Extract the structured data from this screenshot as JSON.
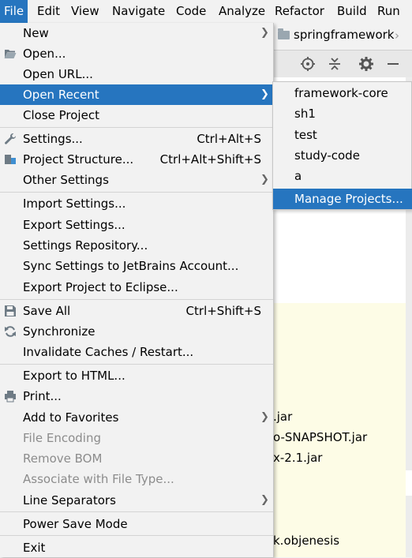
{
  "menubar": {
    "items": [
      "File",
      "Edit",
      "View",
      "Navigate",
      "Code",
      "Analyze",
      "Refactor",
      "Build",
      "Run"
    ],
    "active_item": "File"
  },
  "breadcrumb": {
    "project": "springframework"
  },
  "background_text": [
    ".jar",
    "o-SNAPSHOT.jar",
    "x-2.1.jar",
    "k.objenesis"
  ],
  "file_menu": {
    "items": [
      {
        "label": "New",
        "submenu": true
      },
      {
        "label": "Open...",
        "icon": "folder-open-icon"
      },
      {
        "label": "Open URL..."
      },
      {
        "label": "Open Recent",
        "submenu": true,
        "highlighted": true
      },
      {
        "label": "Close Project"
      },
      {
        "label": "Settings...",
        "shortcut": "Ctrl+Alt+S",
        "icon": "wrench-icon"
      },
      {
        "label": "Project Structure...",
        "shortcut": "Ctrl+Alt+Shift+S",
        "icon": "project-structure-icon"
      },
      {
        "label": "Other Settings",
        "submenu": true
      },
      {
        "label": "Import Settings..."
      },
      {
        "label": "Export Settings..."
      },
      {
        "label": "Settings Repository..."
      },
      {
        "label": "Sync Settings to JetBrains Account..."
      },
      {
        "label": "Export Project to Eclipse..."
      },
      {
        "label": "Save All",
        "shortcut": "Ctrl+Shift+S",
        "icon": "save-icon"
      },
      {
        "label": "Synchronize",
        "icon": "sync-icon"
      },
      {
        "label": "Invalidate Caches / Restart..."
      },
      {
        "label": "Export to HTML..."
      },
      {
        "label": "Print...",
        "icon": "printer-icon"
      },
      {
        "label": "Add to Favorites",
        "submenu": true
      },
      {
        "label": "File Encoding",
        "disabled": true
      },
      {
        "label": "Remove BOM",
        "disabled": true
      },
      {
        "label": "Associate with File Type...",
        "disabled": true
      },
      {
        "label": "Line Separators",
        "submenu": true
      },
      {
        "label": "Power Save Mode"
      },
      {
        "label": "Exit"
      }
    ]
  },
  "open_recent_submenu": {
    "items": [
      {
        "label": "framework-core"
      },
      {
        "label": "sh1"
      },
      {
        "label": "test"
      },
      {
        "label": "study-code"
      },
      {
        "label": "a"
      },
      {
        "label": "Manage Projects...",
        "highlighted": true
      }
    ]
  },
  "colors": {
    "highlight": "#2675bf",
    "menu_background": "#f2f2f2",
    "editor_yellow": "#fdfce6"
  }
}
